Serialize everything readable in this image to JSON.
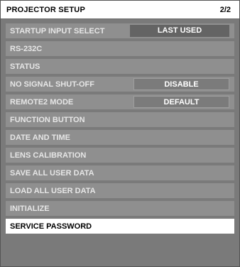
{
  "header": {
    "title": "PROJECTOR SETUP",
    "page_indicator": "2/2"
  },
  "menu": {
    "items": [
      {
        "label": "STARTUP INPUT SELECT",
        "value": "LAST USED"
      },
      {
        "label": "RS-232C"
      },
      {
        "label": "STATUS"
      },
      {
        "label": "NO SIGNAL SHUT-OFF",
        "value": "DISABLE"
      },
      {
        "label": "REMOTE2 MODE",
        "value": "DEFAULT"
      },
      {
        "label": "FUNCTION BUTTON"
      },
      {
        "label": "DATE AND TIME"
      },
      {
        "label": "LENS CALIBRATION"
      },
      {
        "label": "SAVE ALL USER DATA"
      },
      {
        "label": "LOAD ALL USER DATA"
      },
      {
        "label": "INITIALIZE"
      },
      {
        "label": "SERVICE PASSWORD",
        "selected": true
      }
    ]
  },
  "colors": {
    "panel_background": "#7a7a7a",
    "row_background": "#8f8f8f",
    "selected_row_background": "#ffffff",
    "value_box_background": "#646464",
    "label_text": "#e6e6e6",
    "selected_label_text": "#000000"
  }
}
